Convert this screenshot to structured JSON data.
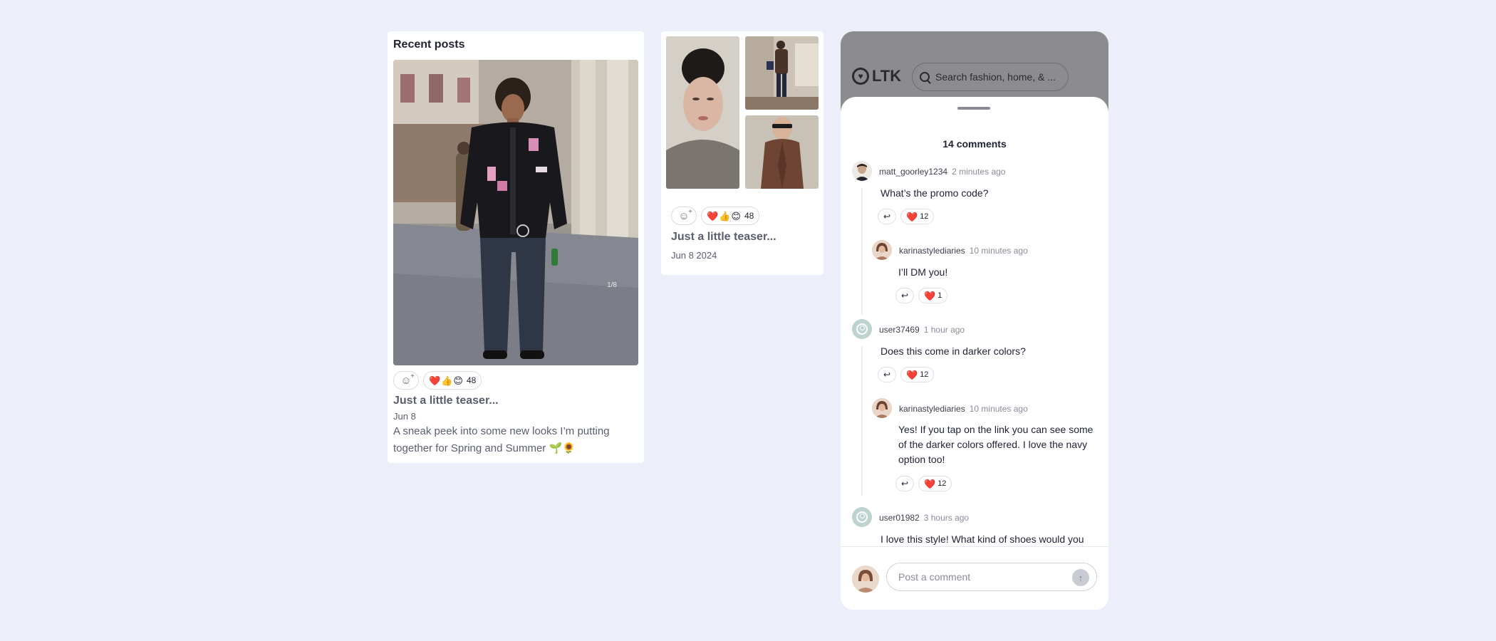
{
  "recent_posts": {
    "title": "Recent posts",
    "photo_counter": "1/8",
    "reactions": {
      "emojis": [
        "❤️",
        "👍",
        "😊"
      ],
      "count": "48"
    },
    "post": {
      "title": "Just a little teaser...",
      "date": "Jun 8",
      "description": "A sneak peek into some new looks I’m putting together for Spring and Summer 🌱🌻"
    }
  },
  "collage_post": {
    "reactions": {
      "emojis": [
        "❤️",
        "👍",
        "😊"
      ],
      "count": "48"
    },
    "title": "Just a little teaser...",
    "date": "Jun 8 2024"
  },
  "app_header": {
    "logo_text": "LTK",
    "search_placeholder": "Search fashion, home, & ..."
  },
  "comments": {
    "title": "14 comments",
    "items": [
      {
        "user": "matt_goorley1234",
        "time": "2 minutes ago",
        "text": "What’s the promo code?",
        "likes": "12"
      },
      {
        "user": "karinastylediaries",
        "time": "10 minutes ago",
        "text": "I’ll DM you!",
        "likes": "1"
      },
      {
        "user": "user37469",
        "time": "1 hour ago",
        "text": "Does this come in darker colors?",
        "likes": "12"
      },
      {
        "user": "karinastylediaries",
        "time": "10 minutes ago",
        "text": "Yes! If you tap on the link you can see some of the darker colors offered. I love the navy option too!",
        "likes": "12"
      },
      {
        "user": "user01982",
        "time": "3 hours ago",
        "text": "I love this style! What kind of shoes would you",
        "likes": ""
      }
    ],
    "composer_placeholder": "Post a comment"
  },
  "colors": {
    "background": "#eceff9",
    "header_gray": "#8c8c8e",
    "text_dark": "#1f2233",
    "text_muted": "#5a5e6e"
  },
  "icons": [
    "add-reaction-icon",
    "reply-arrow-icon",
    "heart-icon",
    "search-icon",
    "send-arrow-icon",
    "ltk-logo-icon"
  ]
}
